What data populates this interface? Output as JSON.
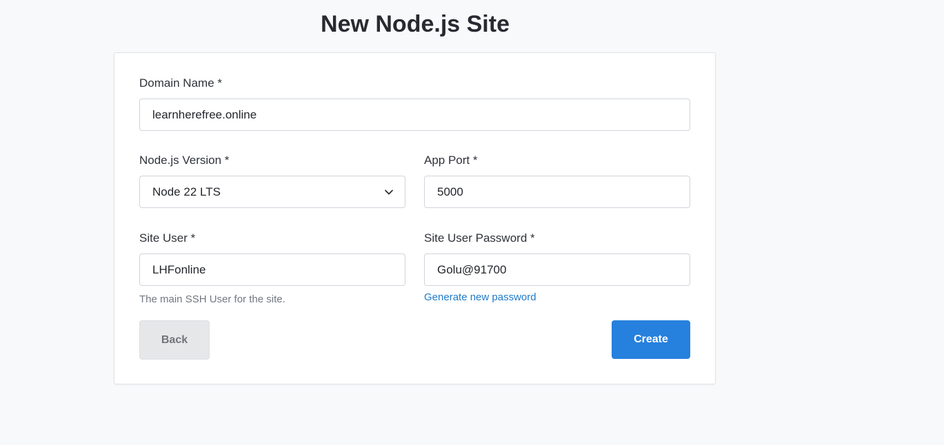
{
  "page": {
    "title": "New Node.js Site"
  },
  "form": {
    "domain": {
      "label": "Domain Name *",
      "value": "learnherefree.online"
    },
    "node_version": {
      "label": "Node.js Version *",
      "selected": "Node 22 LTS",
      "icon": "chevron-down-icon"
    },
    "app_port": {
      "label": "App Port *",
      "value": "5000"
    },
    "site_user": {
      "label": "Site User *",
      "value": "LHFonline",
      "help": "The main SSH User for the site."
    },
    "site_user_password": {
      "label": "Site User Password *",
      "value": "Golu@91700",
      "generate_link": "Generate new password"
    },
    "buttons": {
      "back": "Back",
      "create": "Create"
    }
  },
  "colors": {
    "primary": "#2680dd",
    "link": "#1f7bc9",
    "background": "#f8f9fb"
  }
}
